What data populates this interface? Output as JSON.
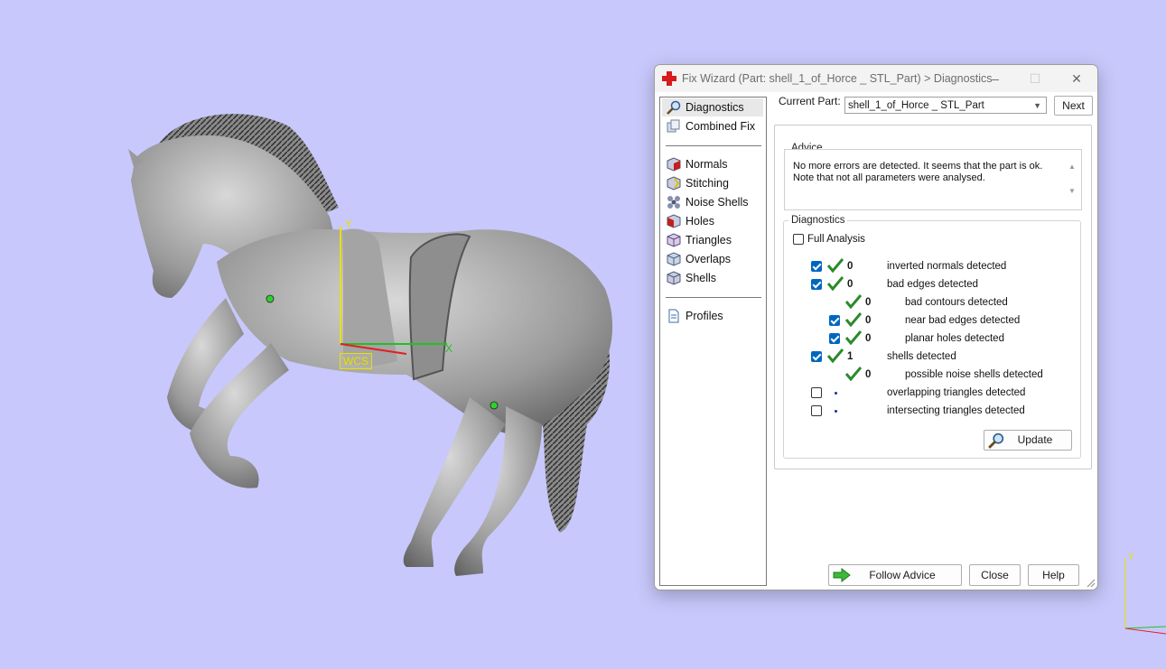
{
  "viewport": {
    "wcs_label": "WCS",
    "axis_y": "Y",
    "axis_x": "X",
    "background_color": "#c8c8fc"
  },
  "dialog": {
    "title": "Fix Wizard (Part: shell_1_of_Horce _ STL_Part) > Diagnostics",
    "title_icon": "red-cross-icon",
    "controls": {
      "minimize": "–",
      "maximize": "☐",
      "close": "✕"
    },
    "nav": {
      "items": [
        {
          "label": "Diagnostics",
          "icon": "magnifier-icon",
          "selected": true
        },
        {
          "label": "Combined Fix",
          "icon": "combined-fix-icon"
        },
        {
          "label": "Normals",
          "icon": "normals-cube-icon"
        },
        {
          "label": "Stitching",
          "icon": "stitching-cube-icon"
        },
        {
          "label": "Noise Shells",
          "icon": "noise-shells-icon"
        },
        {
          "label": "Holes",
          "icon": "holes-cube-icon"
        },
        {
          "label": "Triangles",
          "icon": "triangles-cube-icon"
        },
        {
          "label": "Overlaps",
          "icon": "overlaps-cube-icon"
        },
        {
          "label": "Shells",
          "icon": "shells-cube-icon"
        },
        {
          "label": "Profiles",
          "icon": "document-icon"
        }
      ]
    },
    "current_part": {
      "label": "Current Part:",
      "value": "shell_1_of_Horce _ STL_Part",
      "next_label": "Next"
    },
    "advice": {
      "legend": "Advice",
      "text": "No more errors are detected. It seems that the part is ok.\nNote that not all parameters were analysed."
    },
    "diagnostics": {
      "legend": "Diagnostics",
      "full_analysis_label": "Full Analysis",
      "full_analysis_checked": false,
      "rows": [
        {
          "label": "inverted normals detected",
          "count": "0",
          "checkbox": true,
          "checked": true,
          "status": "ok"
        },
        {
          "label": "bad edges detected",
          "count": "0",
          "checkbox": true,
          "checked": true,
          "status": "ok"
        },
        {
          "label": "bad contours detected",
          "count": "0",
          "checkbox": false,
          "status": "ok"
        },
        {
          "label": "near bad edges detected",
          "count": "0",
          "checkbox": true,
          "checked": true,
          "status": "ok"
        },
        {
          "label": "planar holes detected",
          "count": "0",
          "checkbox": true,
          "checked": true,
          "status": "ok"
        },
        {
          "label": "shells detected",
          "count": "1",
          "checkbox": true,
          "checked": true,
          "status": "ok"
        },
        {
          "label": "possible noise shells detected",
          "count": "0",
          "checkbox": false,
          "status": "ok"
        },
        {
          "label": "overlapping triangles detected",
          "count": "",
          "checkbox": true,
          "checked": false,
          "status": "not-analysed"
        },
        {
          "label": "intersecting triangles detected",
          "count": "",
          "checkbox": true,
          "checked": false,
          "status": "not-analysed"
        }
      ],
      "update_label": "Update"
    },
    "footer": {
      "follow_advice_label": "Follow Advice",
      "close_label": "Close",
      "help_label": "Help"
    }
  }
}
